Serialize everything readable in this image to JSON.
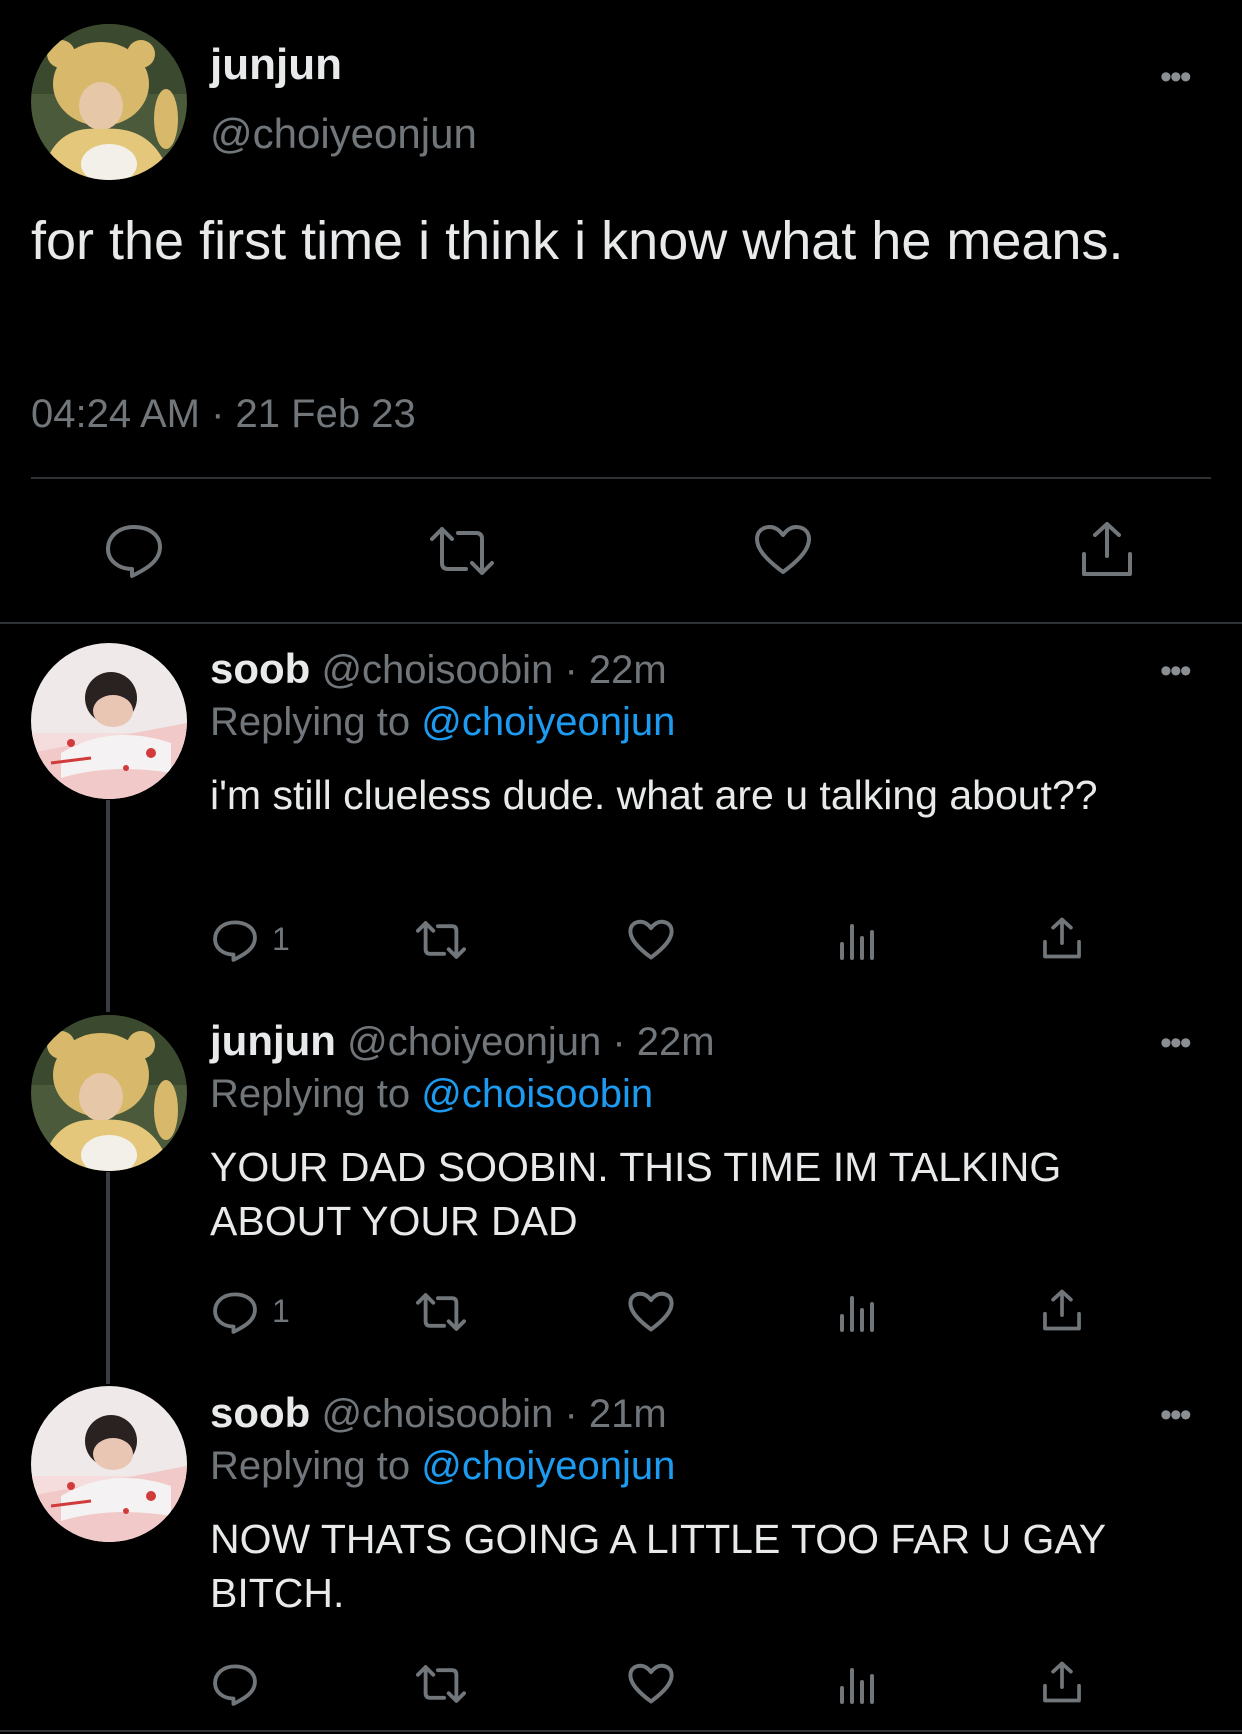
{
  "main_tweet": {
    "display_name": "junjun",
    "handle": "@choiyeonjun",
    "text": "for the first time i think i know what he means.",
    "timestamp": "04:24 AM · 21 Feb 23",
    "more": "•••"
  },
  "replies": [
    {
      "display_name": "soob",
      "handle": "@choisoobin",
      "time": "· 22m",
      "replying_prefix": "Replying to",
      "replying_to": "@choiyeonjun",
      "text": "i'm still clueless dude. what are u talking about??",
      "reply_count": "1",
      "more": "•••"
    },
    {
      "display_name": "junjun",
      "handle": "@choiyeonjun",
      "time": "· 22m",
      "replying_prefix": "Replying to",
      "replying_to": "@choisoobin",
      "text": "YOUR DAD SOOBIN. THIS TIME IM TALKING ABOUT YOUR DAD",
      "reply_count": "1",
      "more": "•••"
    },
    {
      "display_name": "soob",
      "handle": "@choisoobin",
      "time": "· 21m",
      "replying_prefix": "Replying to",
      "replying_to": "@choiyeonjun",
      "text": "NOW THATS GOING A LITTLE TOO FAR U GAY BITCH.",
      "reply_count": "",
      "more": "•••"
    }
  ],
  "icons": {
    "reply": "reply-icon",
    "retweet": "retweet-icon",
    "like": "heart-icon",
    "views": "views-icon",
    "share": "share-icon",
    "more": "more-icon"
  },
  "colors": {
    "background": "#000000",
    "text": "#e7e9ea",
    "secondary": "#71767b",
    "link": "#1d9bf0",
    "divider": "#2f3336"
  }
}
